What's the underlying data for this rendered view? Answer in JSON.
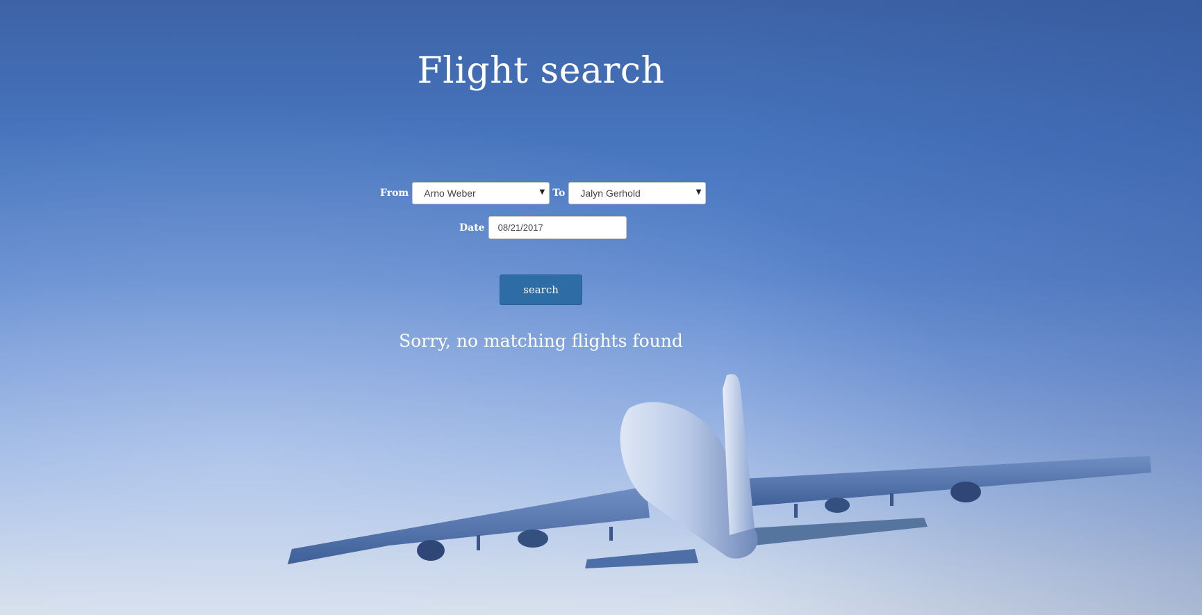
{
  "page": {
    "title": "Flight search"
  },
  "form": {
    "from_label": "From",
    "from_value": "Arno Weber",
    "to_label": "To",
    "to_value": "Jalyn Gerhold",
    "date_label": "Date",
    "date_value": "08/21/2017",
    "search_label": "search"
  },
  "results": {
    "message": "Sorry, no matching flights found"
  },
  "icons": {
    "dropdown_arrow": "chevron-down-icon",
    "background": "airplane-image"
  },
  "colors": {
    "button": "#2e6ca6",
    "text": "#ffffff"
  }
}
